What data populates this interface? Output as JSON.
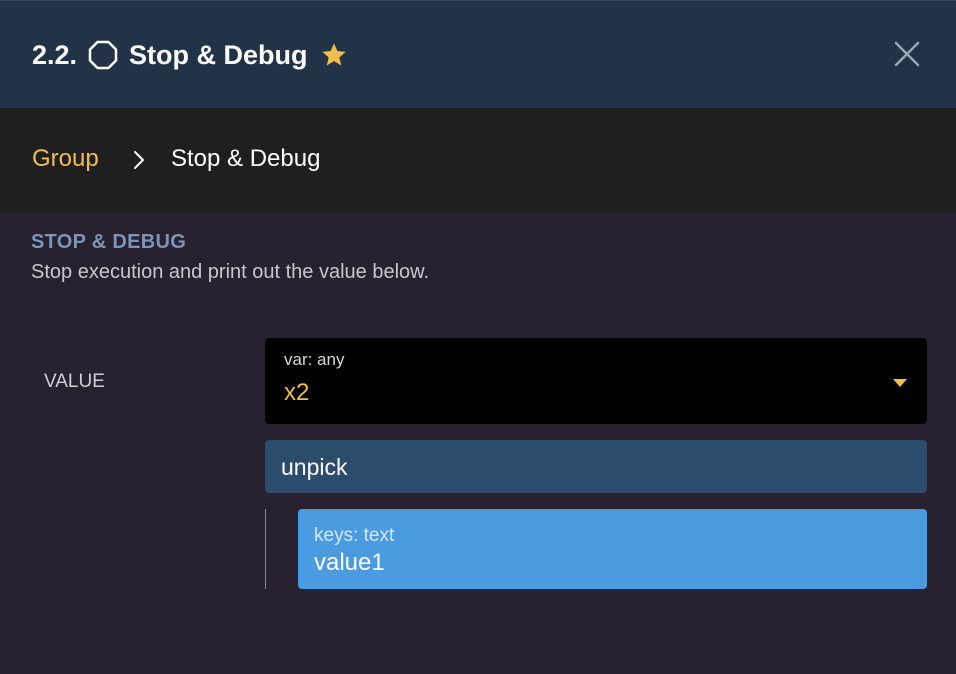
{
  "header": {
    "number": "2.2.",
    "title": "Stop & Debug",
    "icon": "octagon-icon",
    "favorite_icon": "star-icon",
    "close_icon": "close-icon"
  },
  "breadcrumb": {
    "parent": "Group",
    "separator_icon": "chevron-right-icon",
    "current": "Stop & Debug"
  },
  "section": {
    "title": "STOP & DEBUG",
    "description": "Stop execution and print out the value below."
  },
  "field": {
    "label": "VALUE",
    "variable": {
      "type_label": "var: any",
      "value": "x2"
    },
    "operation_label": "unpick",
    "keys": {
      "type_label": "keys: text",
      "value": "value1"
    }
  },
  "colors": {
    "header_bg": "#223348",
    "breadcrumb_bg": "#1f1f1f",
    "body_bg": "#272130",
    "accent_yellow": "#f1bd4f",
    "section_title": "#7d95b8",
    "operation_bg": "#2c4c6c",
    "key_field_bg": "#4a9be0"
  }
}
